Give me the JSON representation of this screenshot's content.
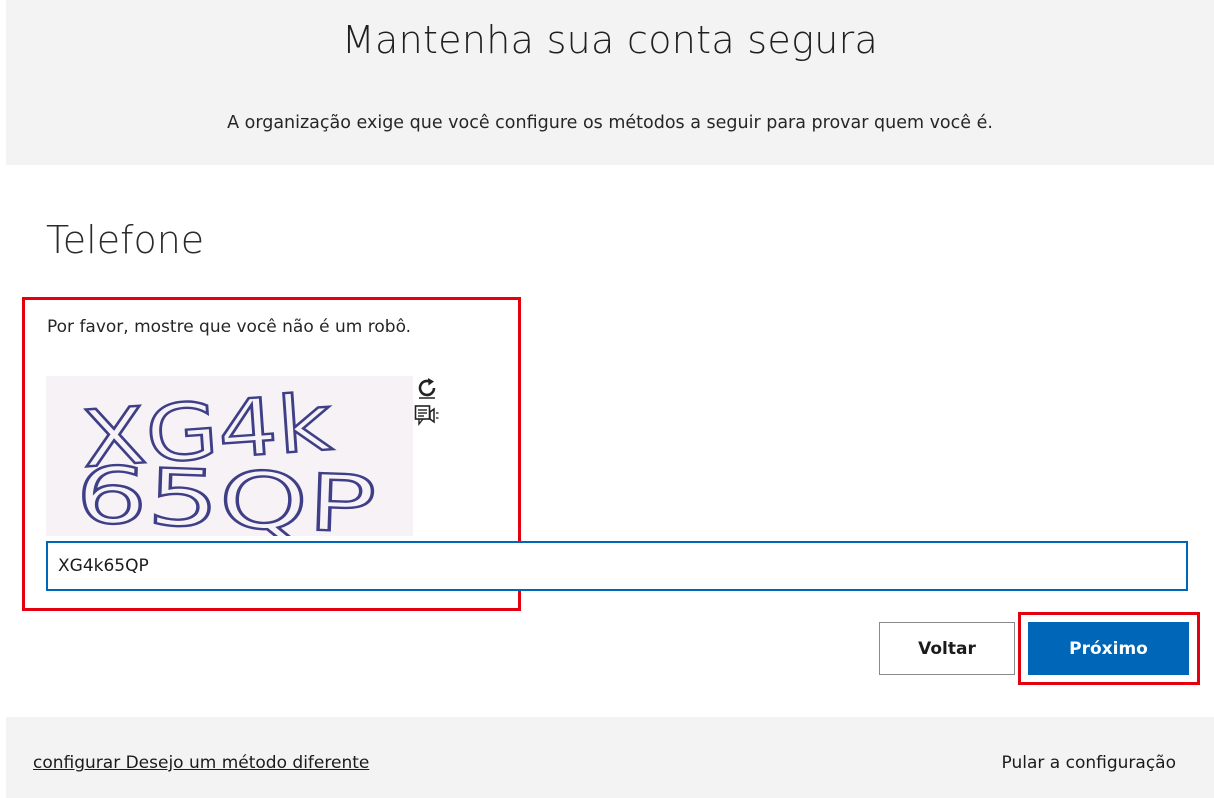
{
  "header": {
    "title": "Mantenha sua conta segura",
    "subtitle": "A organização exige que você configure os métodos a seguir para provar quem você é."
  },
  "section": {
    "title": "Telefone"
  },
  "captcha": {
    "prompt": "Por favor, mostre que você não é um robô.",
    "image_text_line1": "XG4k",
    "image_text_line2": "65QP",
    "refresh_icon": "refresh-icon",
    "audio_icon": "audio-captcha-icon",
    "input_value": "XG4k65QP"
  },
  "buttons": {
    "back_label": "Voltar",
    "next_label": "Próximo"
  },
  "footer": {
    "alt_method_label": "configurar Desejo um método diferente",
    "skip_label": "Pular a configuração"
  },
  "colors": {
    "accent": "#0067b8",
    "highlight": "#e3000f",
    "header_bg": "#f3f3f3"
  }
}
